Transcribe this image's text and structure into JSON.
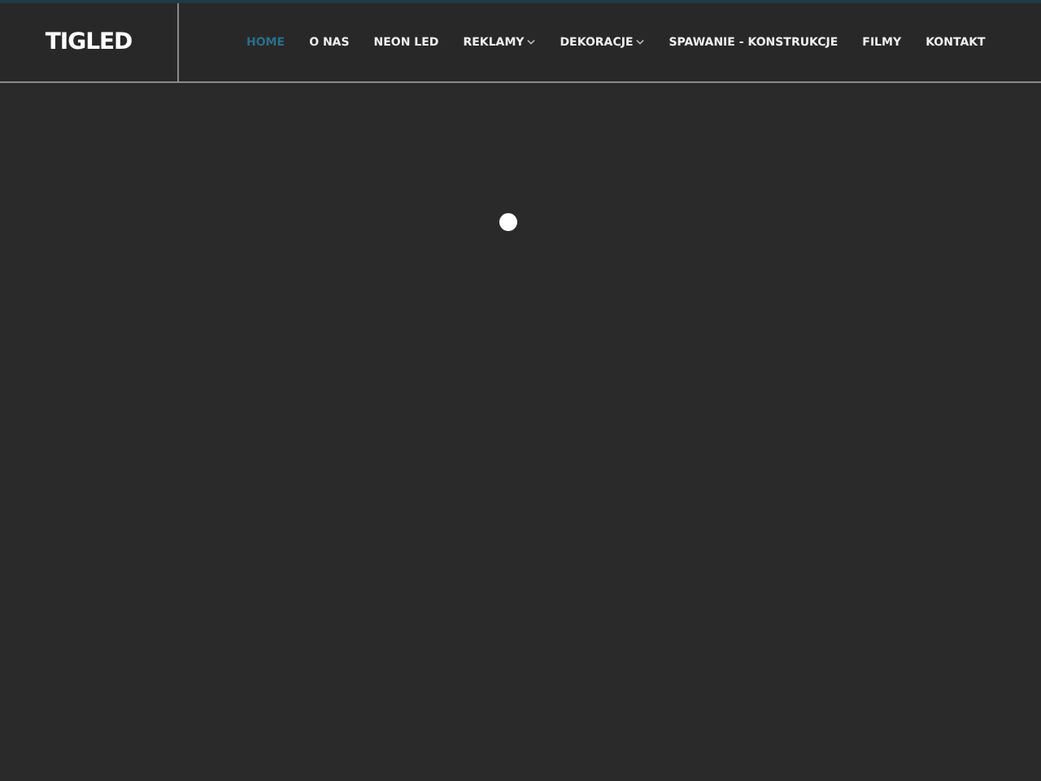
{
  "logo": {
    "text": "TIGLED"
  },
  "nav": [
    {
      "label": "HOME",
      "selected": true,
      "has_dropdown": false
    },
    {
      "label": "O NAS",
      "selected": false,
      "has_dropdown": false
    },
    {
      "label": "NEON LED",
      "selected": false,
      "has_dropdown": false
    },
    {
      "label": "REKLAMY",
      "selected": false,
      "has_dropdown": true
    },
    {
      "label": "DEKORACJE",
      "selected": false,
      "has_dropdown": true
    },
    {
      "label": "SPAWANIE - KONSTRUKCJE",
      "selected": false,
      "has_dropdown": false
    },
    {
      "label": "FILMY",
      "selected": false,
      "has_dropdown": false
    },
    {
      "label": "KONTAKT",
      "selected": false,
      "has_dropdown": false
    }
  ],
  "loader": {
    "kind": "spinner"
  }
}
